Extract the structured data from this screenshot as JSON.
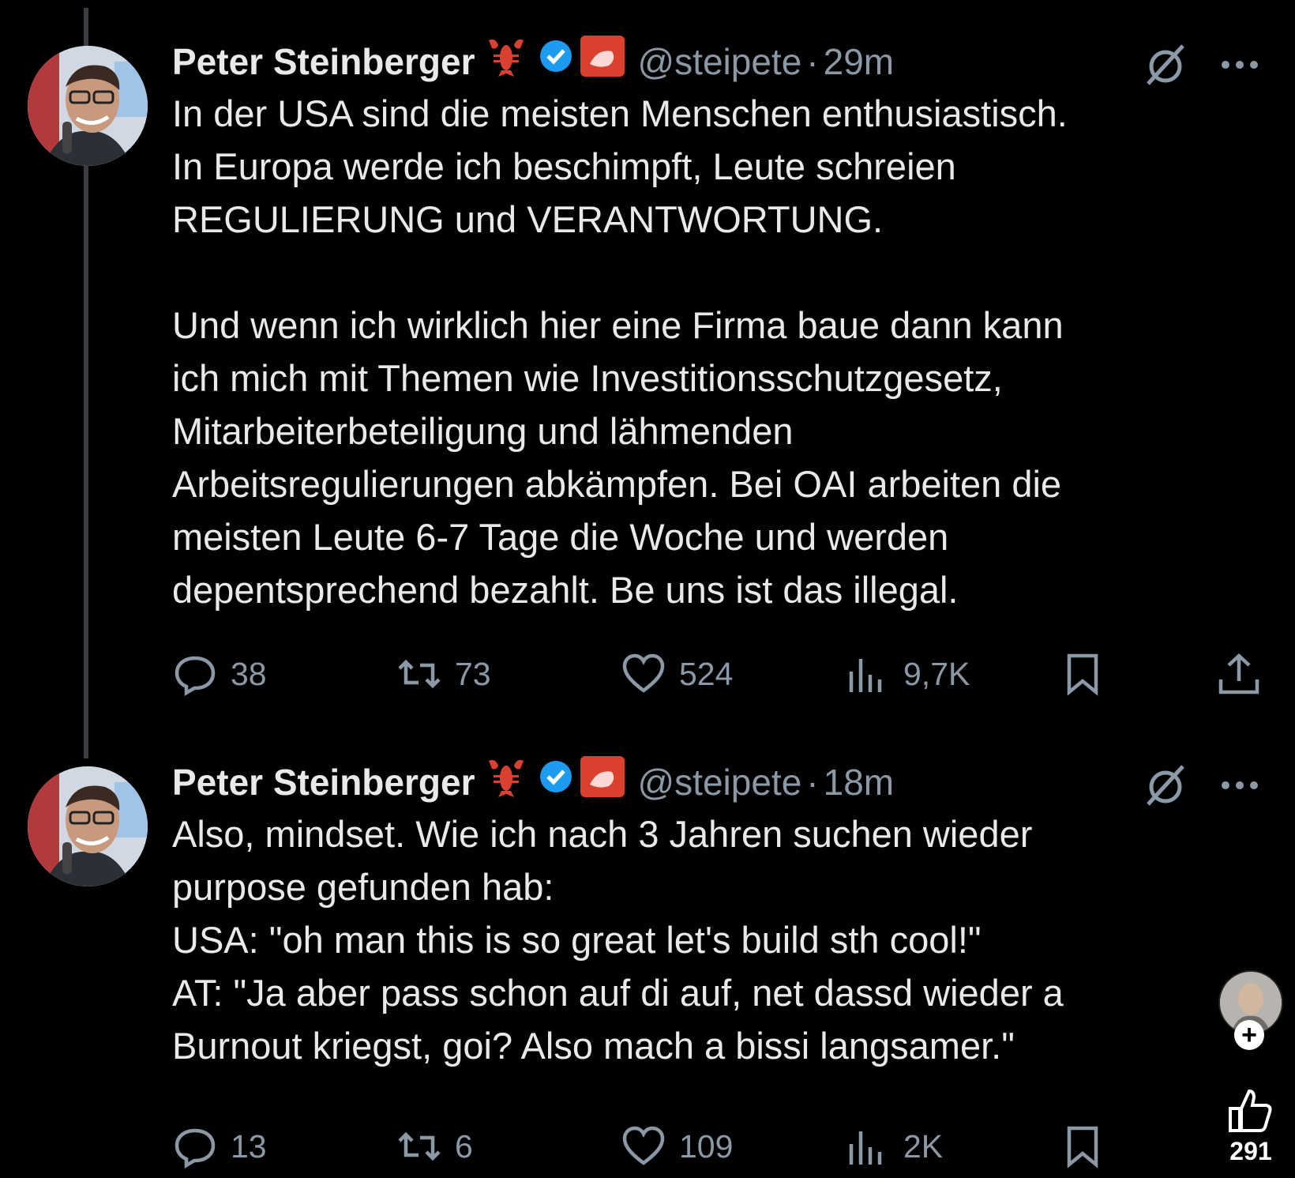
{
  "tweets": [
    {
      "author": "Peter Steinberger",
      "handle": "@steipete",
      "separator": "·",
      "time": "29m",
      "text": "In der USA sind die meisten Menschen enthusiastisch.\nIn Europa werde ich beschimpft, Leute schreien\nREGULIERUNG und VERANTWORTUNG.\n\nUnd wenn ich wirklich hier eine Firma baue dann kann\nich mich mit Themen wie Investitionsschutzgesetz,\nMitarbeiterbeteiligung und lähmenden\nArbeitsregulierungen abkämpfen. Bei OAI arbeiten die\nmeisten Leute 6-7 Tage die Woche und werden\ndepentsprechend bezahlt. Be uns ist das illegal.",
      "replies": "38",
      "reposts": "73",
      "likes": "524",
      "views": "9,7K"
    },
    {
      "author": "Peter Steinberger",
      "handle": "@steipete",
      "separator": "·",
      "time": "18m",
      "text": "Also, mindset. Wie ich nach 3 Jahren suchen wieder\npurpose gefunden hab:\nUSA: \"oh man this is so great let's build sth cool!\"\nAT: \"Ja aber pass schon auf di auf, net dassd wieder a\nBurnout kriegst, goi? Also mach a bissi langsamer.\"",
      "replies": "13",
      "reposts": "6",
      "likes": "109",
      "views": "2K"
    }
  ],
  "overlay": {
    "plus": "+",
    "like_count": "291"
  },
  "colors": {
    "background": "#000000",
    "text": "#e7e9ea",
    "muted": "#8b98a5",
    "verified": "#1d9bf0",
    "thread_line": "#3a3d41",
    "lobster": "#d9412e"
  },
  "icons": [
    "lobster-icon",
    "verified-badge-icon",
    "lobster-flag-icon",
    "grok-icon",
    "more-icon",
    "reply-icon",
    "repost-icon",
    "like-icon",
    "views-icon",
    "bookmark-icon",
    "share-icon",
    "thumbs-up-icon"
  ]
}
